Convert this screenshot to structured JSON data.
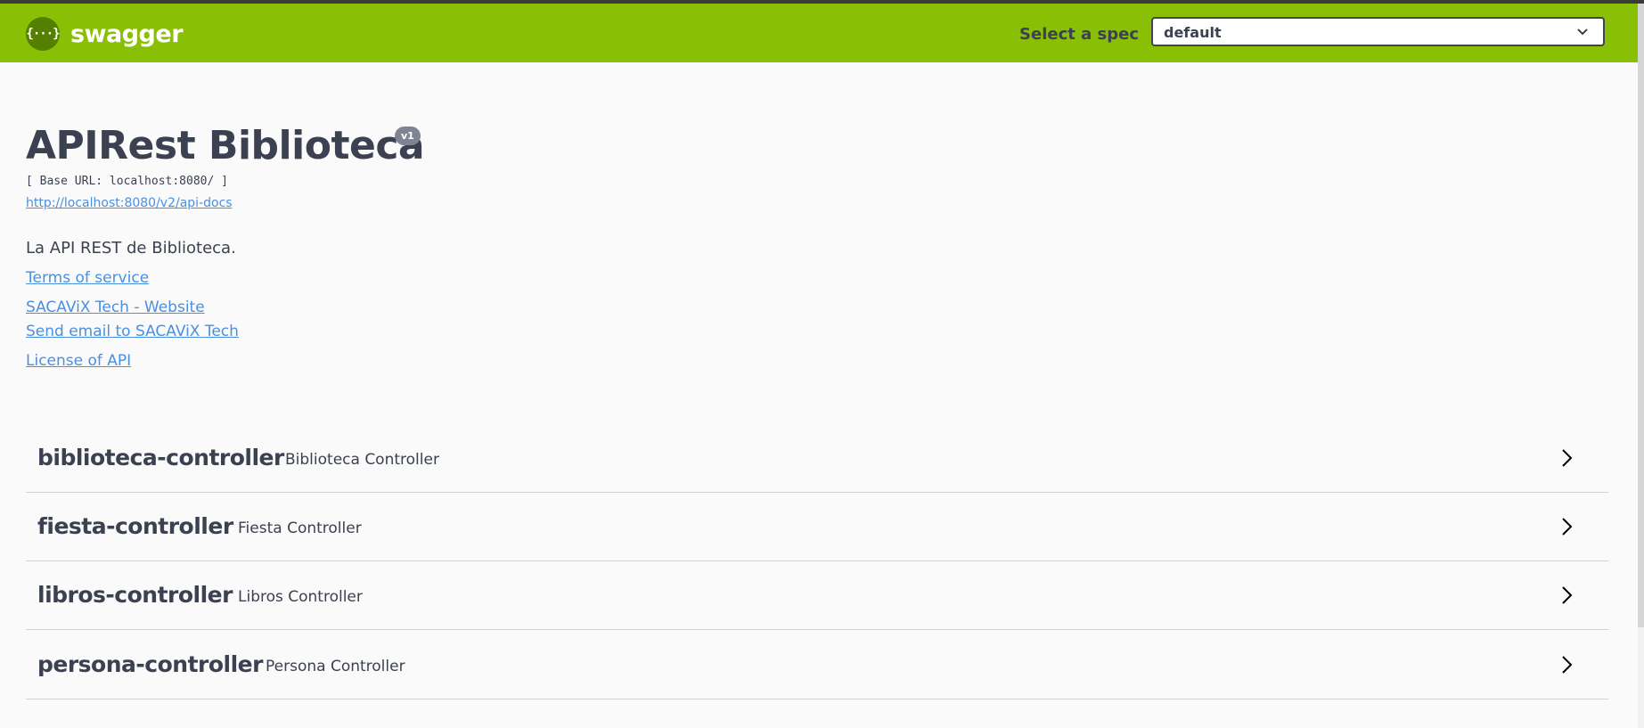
{
  "header": {
    "logo_text": "swagger",
    "logo_glyph": "{···}",
    "spec_label": "Select a spec",
    "spec_selected": "default",
    "accent_color": "#89bf04"
  },
  "info": {
    "title": "APIRest Biblioteca",
    "version": "v1",
    "base_url": "[ Base URL: localhost:8080/ ]",
    "api_docs_link": "http://localhost:8080/v2/api-docs",
    "description": "La API REST de Biblioteca.",
    "terms_link": "Terms of service",
    "website_link": "SACAViX Tech - Website",
    "email_link": "Send email to SACAViX Tech",
    "license_link": "License of API"
  },
  "tags": [
    {
      "name": "biblioteca-controller",
      "description": "Biblioteca Controller"
    },
    {
      "name": "fiesta-controller",
      "description": "Fiesta Controller"
    },
    {
      "name": "libros-controller",
      "description": "Libros Controller"
    },
    {
      "name": "persona-controller",
      "description": "Persona Controller"
    }
  ]
}
